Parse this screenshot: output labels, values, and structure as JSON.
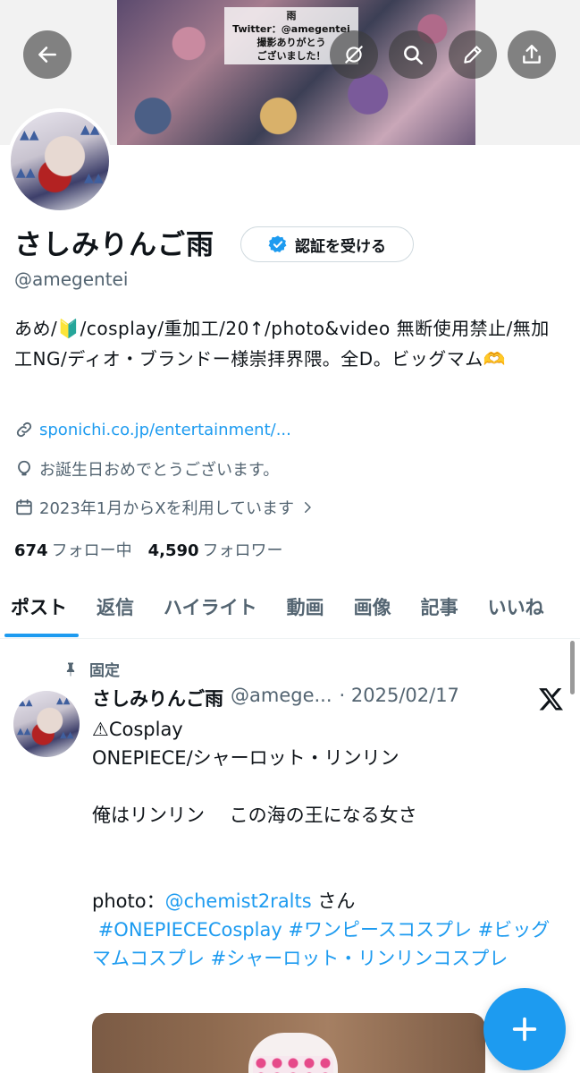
{
  "banner": {
    "note_line1": "雨",
    "note_line2": "Twitter：@amegentei",
    "note_line3": "撮影ありがとう",
    "note_line4": "ございました！"
  },
  "header_actions": {
    "back": "back-arrow-icon",
    "grok": "grok-icon",
    "search": "search-icon",
    "edit": "pencil-icon",
    "share": "share-icon"
  },
  "profile": {
    "display_name": "さしみりんご雨",
    "verify_label": "認証を受ける",
    "handle": "@amegentei",
    "bio": "あめ/🔰/cosplay/重加工/20↑/photo&video 無断使用禁止/無加工NG/ディオ・ブランドー様崇拝界隈。全D。ビッグマム🫶",
    "website": "sponichi.co.jp/entertainment/...",
    "birthday": "お誕生日おめでとうございます。",
    "joined": "2023年1月からXを利用しています",
    "following_count": "674",
    "following_label": "フォロー中",
    "followers_count": "4,590",
    "followers_label": "フォロワー"
  },
  "tabs": [
    {
      "label": "ポスト"
    },
    {
      "label": "返信"
    },
    {
      "label": "ハイライト"
    },
    {
      "label": "動画"
    },
    {
      "label": "画像"
    },
    {
      "label": "記事"
    },
    {
      "label": "いいね"
    }
  ],
  "post": {
    "pinned_label": "固定",
    "author_name": "さしみりんご雨",
    "author_handle": "@amege...",
    "date": "· 2025/02/17",
    "line1": "⚠Cosplay",
    "line2": "ONEPIECE/シャーロット・リンリン",
    "line3": "俺はリンリン　 この海の王になる女さ",
    "photo_prefix": "photo：",
    "mention": "@chemist2ralts",
    "photo_suffix": " さん",
    "hashtags": " #ONEPIECECosplay #ワンピースコスプレ #ビッグマムコスプレ #シャーロット・リンリンコスプレ"
  },
  "colors": {
    "accent": "#1d9bf0",
    "text": "#0f1419",
    "muted": "#536471"
  }
}
